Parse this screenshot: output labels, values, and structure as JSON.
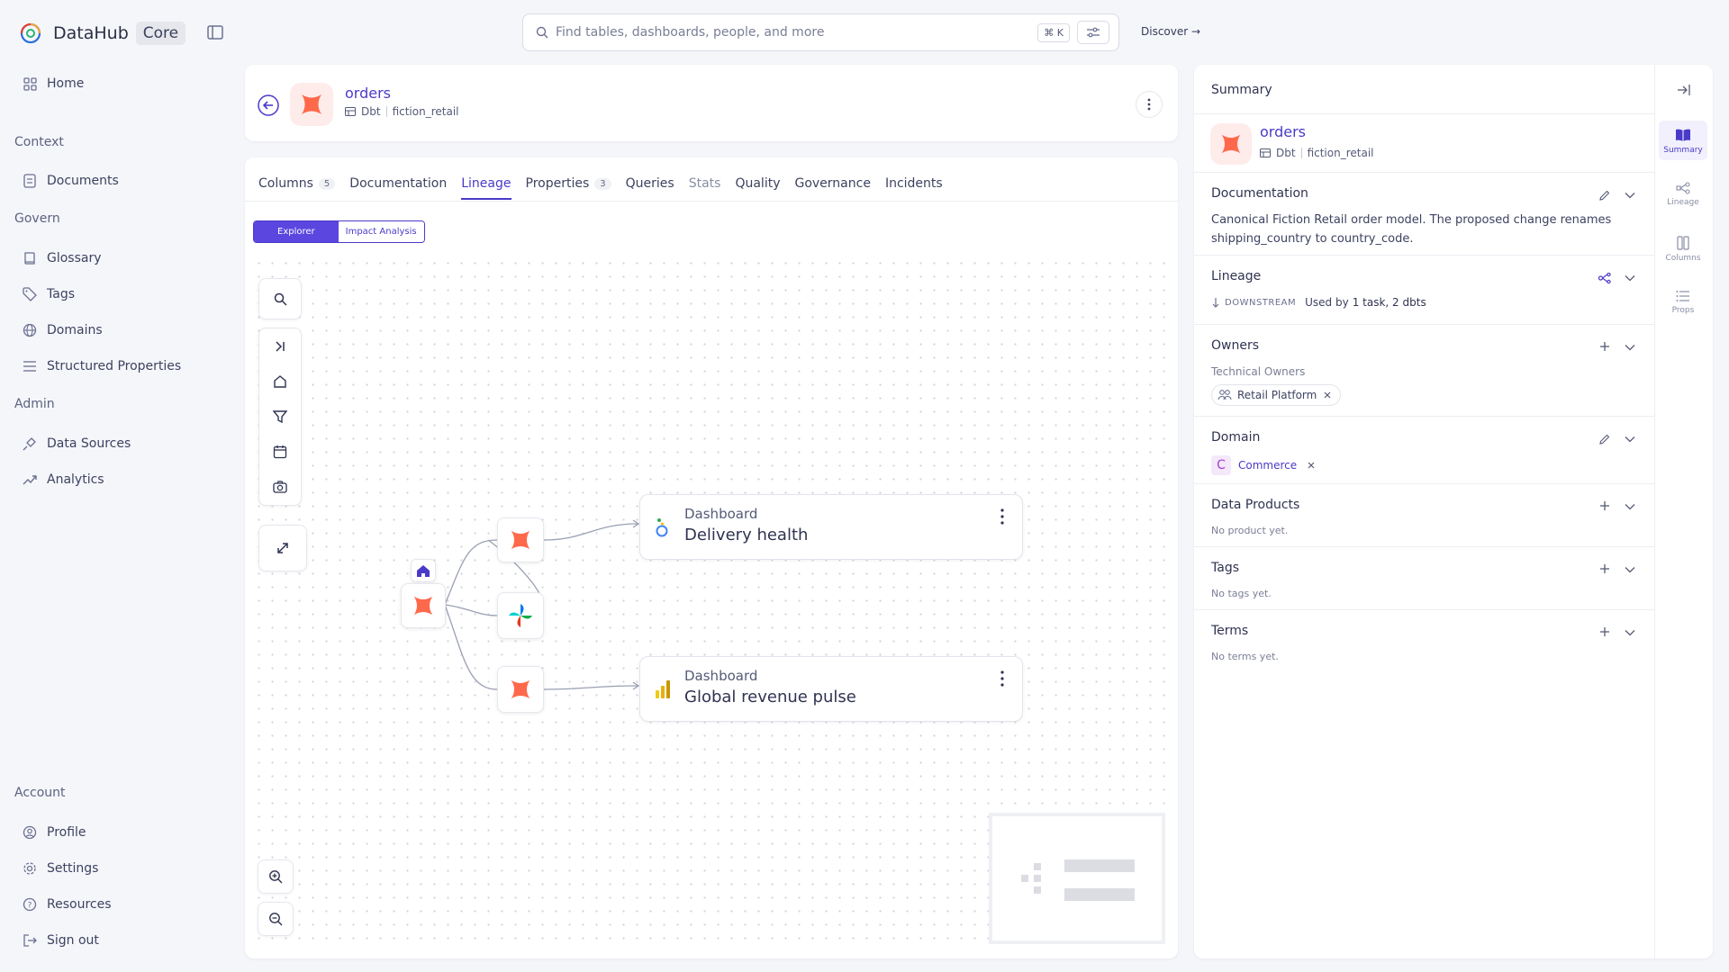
{
  "app": {
    "name": "DataHub",
    "badge": "Core"
  },
  "nav": {
    "home": "Home",
    "context_head": "Context",
    "documents": "Documents",
    "govern_head": "Govern",
    "glossary": "Glossary",
    "tags": "Tags",
    "domains": "Domains",
    "structured": "Structured Properties",
    "admin_head": "Admin",
    "data_sources": "Data Sources",
    "analytics": "Analytics",
    "account_head": "Account",
    "profile": "Profile",
    "settings": "Settings",
    "resources": "Resources",
    "signout": "Sign out"
  },
  "search": {
    "placeholder": "Find tables, dashboards, people, and more",
    "shortcut": "⌘ K"
  },
  "discover": "Discover →",
  "entity": {
    "name": "orders",
    "platform": "Dbt",
    "container": "fiction_retail"
  },
  "tabs": [
    {
      "label": "Columns",
      "count": "5"
    },
    {
      "label": "Documentation"
    },
    {
      "label": "Lineage"
    },
    {
      "label": "Properties",
      "count": "3"
    },
    {
      "label": "Queries"
    },
    {
      "label": "Stats"
    },
    {
      "label": "Quality"
    },
    {
      "label": "Governance"
    },
    {
      "label": "Incidents"
    }
  ],
  "lineage": {
    "mode_on": "Explorer",
    "mode_off": "Impact Analysis",
    "nodes": [
      {
        "type": "Dashboard",
        "name": "Delivery health"
      },
      {
        "type": "Dashboard",
        "name": "Global revenue pulse"
      }
    ]
  },
  "summary": {
    "title": "Summary",
    "documentation_title": "Documentation",
    "documentation_text": "Canonical Fiction Retail order model. The proposed change renames shipping_country to country_code.",
    "lineage_title": "Lineage",
    "lineage_dir": "DOWNSTREAM",
    "lineage_used_prefix": "Used by",
    "lineage_used": "1 task, 2 dbts",
    "owners_title": "Owners",
    "owners_sub": "Technical Owners",
    "owner": "Retail Platform",
    "domain_title": "Domain",
    "domain_letter": "C",
    "domain": "Commerce",
    "dp_title": "Data Products",
    "dp_empty": "No product yet.",
    "tags_title": "Tags",
    "tags_empty": "No tags yet.",
    "terms_title": "Terms",
    "terms_empty": "No terms yet."
  },
  "strip": {
    "summary": "Summary",
    "lineage": "Lineage",
    "columns": "Columns",
    "props": "Props"
  },
  "colors": {
    "accent": "#4a3ac9",
    "dbt": "#ff694b"
  }
}
